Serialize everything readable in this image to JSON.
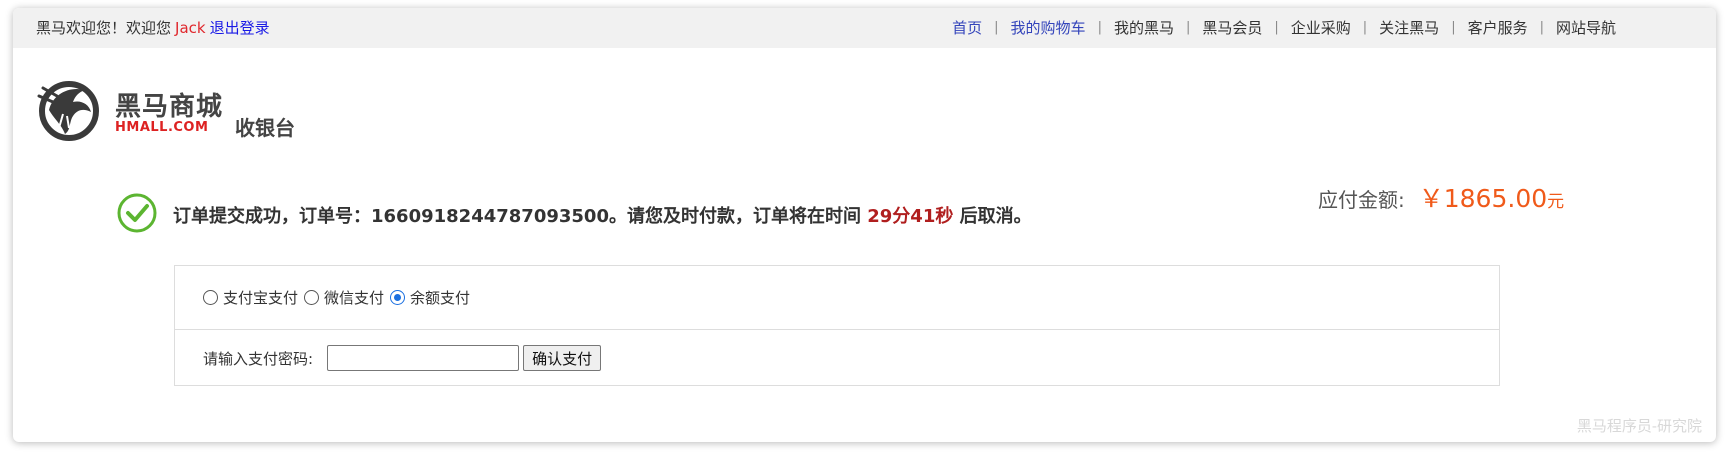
{
  "topbar": {
    "welcome_text": "黑马欢迎您！欢迎您",
    "username": "Jack",
    "logout_label": "退出登录",
    "nav": [
      {
        "label": "首页",
        "link": true
      },
      {
        "label": "我的购物车",
        "link": true
      },
      {
        "label": "我的黑马",
        "link": false
      },
      {
        "label": "黑马会员",
        "link": false
      },
      {
        "label": "企业采购",
        "link": false
      },
      {
        "label": "关注黑马",
        "link": false
      },
      {
        "label": "客户服务",
        "link": false
      },
      {
        "label": "网站导航",
        "link": false
      }
    ]
  },
  "header": {
    "brand_cn": "黑马商城",
    "brand_en": "HMALL.COM",
    "page_title": "收银台"
  },
  "status": {
    "prefix": "订单提交成功，订单号：1660918244787093500。请您及时付款，订单将在时间",
    "time_left": "29分41秒",
    "suffix": "后取消。"
  },
  "amount": {
    "label": "应付金额:",
    "value": "￥1865.00",
    "unit": "元"
  },
  "payment": {
    "options": [
      {
        "label": "支付宝支付",
        "checked": false
      },
      {
        "label": "微信支付",
        "checked": false
      },
      {
        "label": "余额支付",
        "checked": true
      }
    ],
    "password_label": "请输入支付密码:",
    "password_value": "",
    "confirm_label": "确认支付"
  },
  "watermark": "黑马程序员-研究院",
  "colors": {
    "accent_red": "#e0282d",
    "amount_orange": "#f05a1a",
    "success_green": "#5cb531",
    "radio_blue": "#1a6fe0"
  }
}
